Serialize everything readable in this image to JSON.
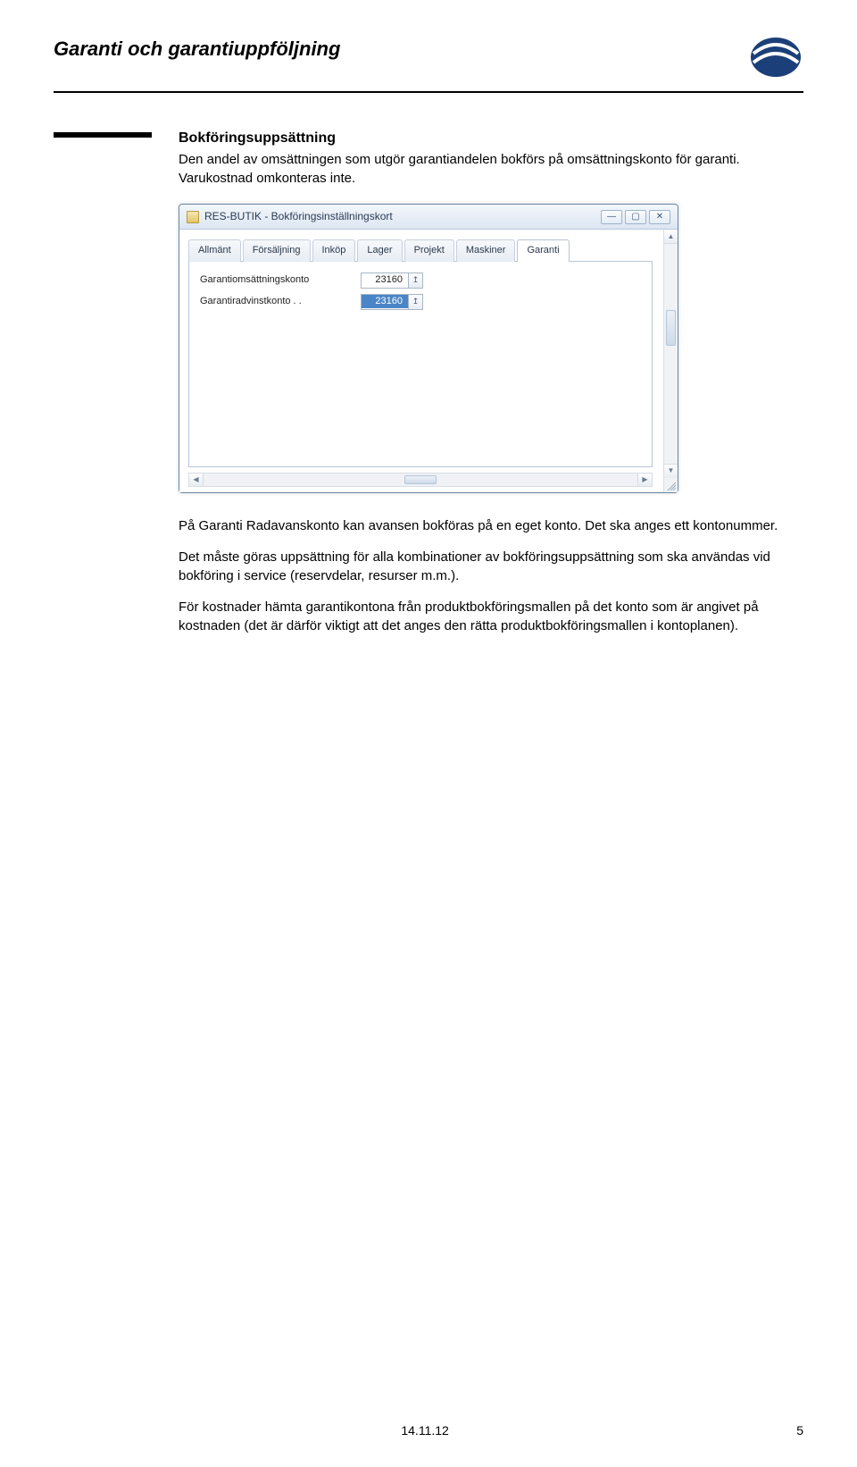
{
  "header": {
    "title": "Garanti och garantiuppföljning"
  },
  "section": {
    "heading": "Bokföringsuppsättning",
    "p1": "Den andel av omsättningen som utgör garantiandelen bokförs på omsättningskonto för garanti. Varukostnad omkonteras inte.",
    "p2": "På Garanti Radavanskonto kan avansen bokföras på en eget konto. Det ska anges ett kontonummer.",
    "p3": "Det måste göras uppsättning för alla kombinationer av bokföringsuppsättning som ska användas vid bokföring i service (reservdelar, resurser m.m.).",
    "p4": "För kostnader hämta garantikontona från produktbokföringsmallen på det konto som är angivet på kostnaden (det är därför viktigt att det anges den rätta produktbokföringsmallen i kontoplanen)."
  },
  "window": {
    "title": "RES-BUTIK - Bokföringsinställningskort",
    "tabs": [
      "Allmänt",
      "Försäljning",
      "Inköp",
      "Lager",
      "Projekt",
      "Maskiner",
      "Garanti"
    ],
    "active_tab_index": 6,
    "fields": [
      {
        "label": "Garantiomsättningskonto",
        "value": "23160",
        "highlight": false
      },
      {
        "label": "Garantiradvinstkonto . .",
        "value": "23160",
        "highlight": true
      }
    ],
    "lookup_glyph": "↥"
  },
  "footer": {
    "date": "14.11.12",
    "page": "5"
  }
}
